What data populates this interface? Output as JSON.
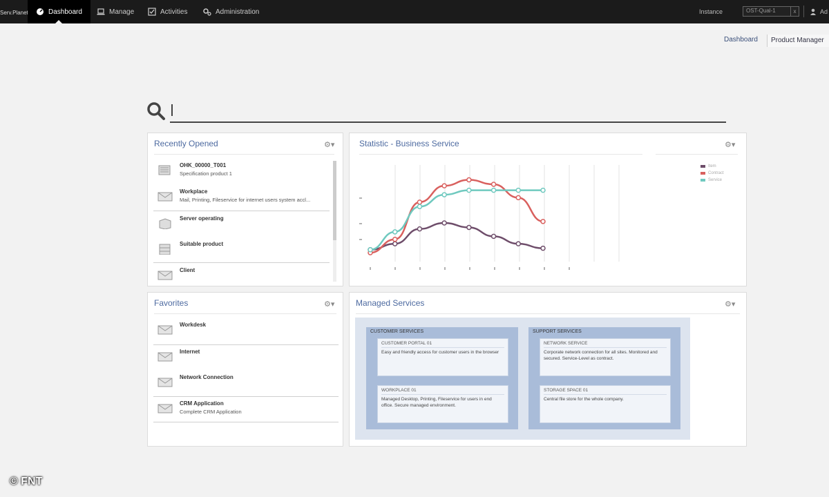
{
  "topbar": {
    "brand": "Serv.Planet",
    "nav": [
      "Dashboard",
      "Manage",
      "Activities",
      "Administration"
    ],
    "instance_label": "Instance",
    "instance_value": "OST-Qual-1",
    "user": "Ad"
  },
  "breadcrumbs": [
    "Dashboard",
    "Product Manager"
  ],
  "search": {
    "placeholder": ""
  },
  "recently_opened": {
    "title": "Recently Opened",
    "items": [
      {
        "name": "OHK_00000_T001",
        "desc": "Specification product 1",
        "icon": "spec-sheet-icon"
      },
      {
        "name": "Workplace",
        "desc": "Mail, Printing, Fileservice for internet users system accl...",
        "icon": "mail-icon"
      },
      {
        "name": "Server operating",
        "desc": "",
        "icon": "box-icon"
      },
      {
        "name": "Suitable product",
        "desc": "",
        "icon": "stack-icon"
      },
      {
        "name": "Client",
        "desc": "",
        "icon": "mail-icon"
      }
    ]
  },
  "favorites": {
    "title": "Favorites",
    "items": [
      {
        "name": "Workdesk",
        "desc": ""
      },
      {
        "name": "Internet",
        "desc": ""
      },
      {
        "name": "Network Connection",
        "desc": ""
      },
      {
        "name": "CRM Application",
        "desc": "Complete CRM Application"
      }
    ]
  },
  "statistic": {
    "title": "Statistic - Business Service",
    "legend": [
      "Item",
      "Contract",
      "Service"
    ]
  },
  "chart_data": {
    "type": "line",
    "x": [
      0,
      1,
      2,
      3,
      4,
      5,
      6,
      7
    ],
    "series": [
      {
        "name": "Item",
        "color": "#6e4d6a",
        "values": [
          8,
          12,
          22,
          26,
          23,
          17,
          12,
          9
        ]
      },
      {
        "name": "Contract",
        "color": "#d9605e",
        "values": [
          6,
          15,
          40,
          51,
          55,
          52,
          43,
          27
        ]
      },
      {
        "name": "Service",
        "color": "#6fc9bf",
        "values": [
          8,
          20,
          37,
          45,
          48,
          48,
          48,
          48
        ]
      }
    ],
    "ylim": [
      0,
      65
    ]
  },
  "managed_services": {
    "title": "Managed Services",
    "groups": [
      {
        "title": "CUSTOMER SERVICES",
        "cards": [
          {
            "head": "CUSTOMER PORTAL 01",
            "body": "Easy and friendly access for customer users in the browser"
          },
          {
            "head": "WORKPLACE 01",
            "body": "Managed Desktop, Printing, Fileservice for users in end office. Secure managed environment."
          }
        ]
      },
      {
        "title": "SUPPORT SERVICES",
        "cards": [
          {
            "head": "NETWORK SERVICE",
            "body": "Corporate network connection for all sites. Monitored and secured. Service-Level as contract."
          },
          {
            "head": "STORAGE SPACE 01",
            "body": "Central file store for the whole company."
          }
        ]
      }
    ]
  },
  "copyright": "© FNT",
  "colors": {
    "topbar": "#1b1b1b",
    "accent": "#4d6aa0",
    "ms_outer": "#dde4ef",
    "ms_group": "#a9bcd9"
  }
}
